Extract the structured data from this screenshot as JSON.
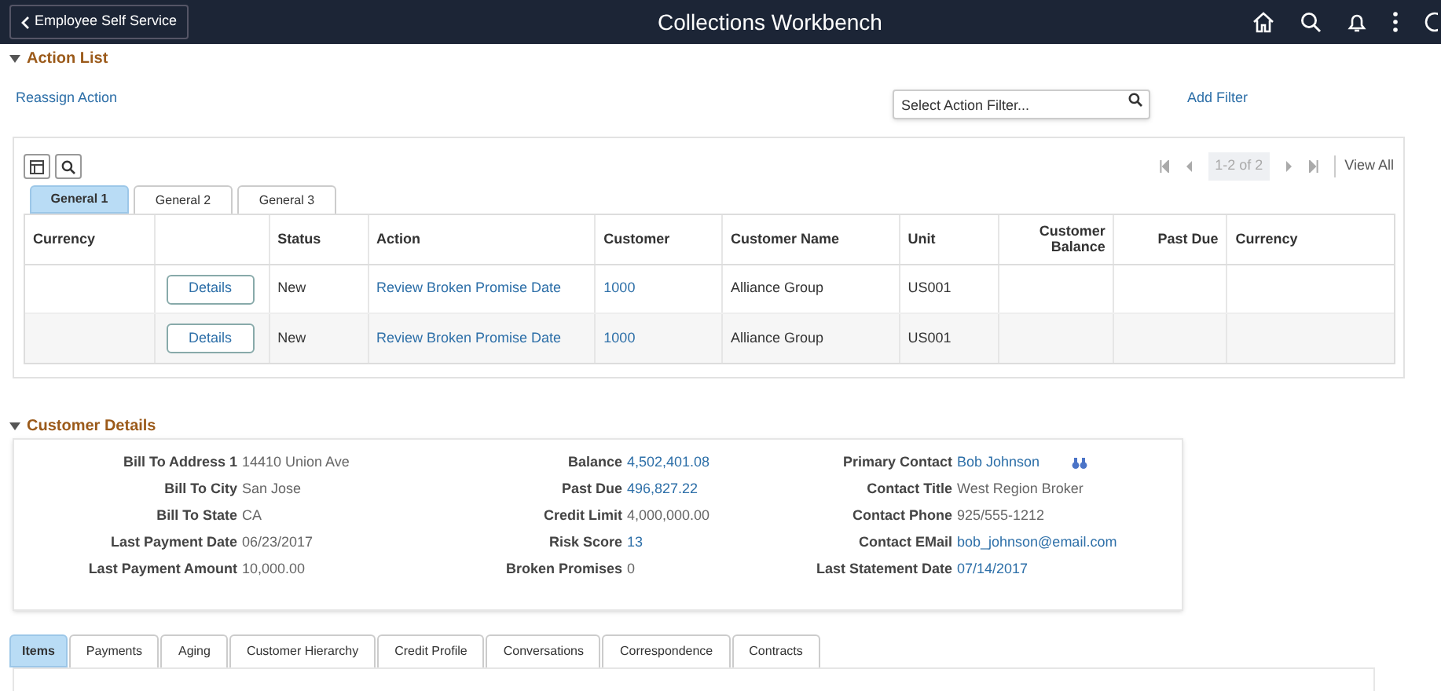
{
  "header": {
    "back": "Employee Self Service",
    "title": "Collections Workbench"
  },
  "action_list": {
    "title": "Action List",
    "reassign": "Reassign Action",
    "filter": {
      "placeholder": "Select Action Filter..."
    },
    "add_filter": "Add Filter",
    "pager": {
      "range": "1-2 of 2",
      "view_all": "View All"
    },
    "tabs": [
      {
        "label": "General 1",
        "selected": true
      },
      {
        "label": "General 2",
        "selected": false
      },
      {
        "label": "General 3",
        "selected": false
      }
    ],
    "columns": [
      "Currency",
      "",
      "Status",
      "Action",
      "Customer",
      "Customer Name",
      "Unit",
      "Customer Balance",
      "Past Due",
      "Currency"
    ],
    "rows": [
      {
        "details": "Details",
        "status": "New",
        "action": "Review Broken Promise Date",
        "customer": "1000",
        "customer_name": "Alliance Group",
        "unit": "US001"
      },
      {
        "details": "Details",
        "status": "New",
        "action": "Review Broken Promise Date",
        "customer": "1000",
        "customer_name": "Alliance Group",
        "unit": "US001"
      }
    ]
  },
  "customer_details": {
    "title": "Customer Details",
    "columns": [
      [
        {
          "label": "Bill To Address 1",
          "value": "14410 Union Ave",
          "link": false
        },
        {
          "label": "Bill To City",
          "value": "San Jose",
          "link": false
        },
        {
          "label": "Bill To State",
          "value": "CA",
          "link": false
        },
        {
          "label": "Last Payment Date",
          "value": "06/23/2017",
          "link": false
        },
        {
          "label": "Last Payment Amount",
          "value": "10,000.00",
          "link": false
        }
      ],
      [
        {
          "label": "Balance",
          "value": "4,502,401.08",
          "link": true
        },
        {
          "label": "Past Due",
          "value": "496,827.22",
          "link": true
        },
        {
          "label": "Credit Limit",
          "value": "4,000,000.00",
          "link": false
        },
        {
          "label": "Risk Score",
          "value": "13",
          "link": true
        },
        {
          "label": "Broken Promises",
          "value": "0",
          "link": false
        }
      ],
      [
        {
          "label": "Primary Contact",
          "value": "Bob Johnson",
          "link": true
        },
        {
          "label": "Contact Title",
          "value": "West Region Broker",
          "link": false
        },
        {
          "label": "Contact Phone",
          "value": "925/555-1212",
          "link": false
        },
        {
          "label": "Contact EMail",
          "value": "bob_johnson@email.com",
          "link": true
        },
        {
          "label": "Last Statement Date",
          "value": "07/14/2017",
          "link": true
        }
      ]
    ]
  },
  "bottom_tabs": [
    {
      "label": "Items",
      "selected": true
    },
    {
      "label": "Payments",
      "selected": false
    },
    {
      "label": "Aging",
      "selected": false
    },
    {
      "label": "Customer Hierarchy",
      "selected": false
    },
    {
      "label": "Credit Profile",
      "selected": false
    },
    {
      "label": "Conversations",
      "selected": false
    },
    {
      "label": "Correspondence",
      "selected": false
    },
    {
      "label": "Contracts",
      "selected": false
    }
  ]
}
